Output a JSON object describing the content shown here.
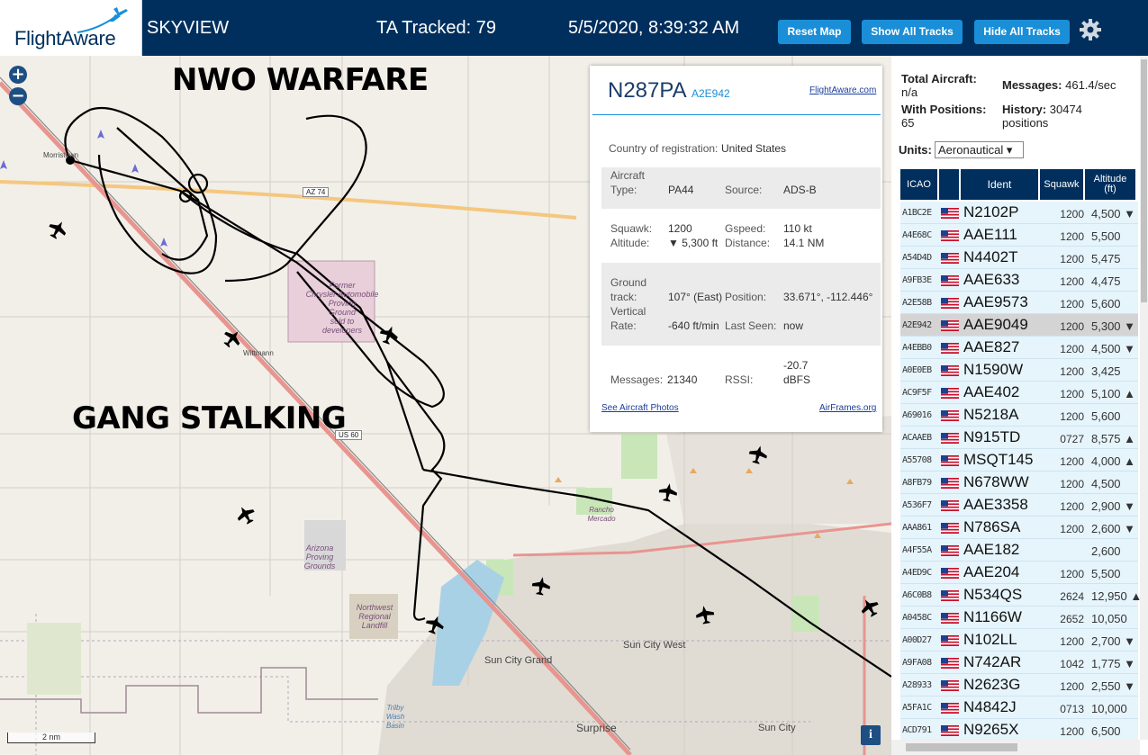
{
  "header": {
    "logo_text": "FlightAware",
    "app_name": "SKYVIEW",
    "tracked": "TA Tracked: 79",
    "datetime": "5/5/2020, 8:39:32 AM",
    "buttons": {
      "reset": "Reset Map",
      "show": "Show All Tracks",
      "hide": "Hide All Tracks"
    }
  },
  "map": {
    "zoom_in": "+",
    "zoom_out": "−",
    "overlay_top": "NWO WARFARE",
    "overlay_bottom": "GANG STALKING",
    "places": {
      "morristown": "Morristown",
      "wittmann": "Wittmann",
      "sun_city_west": "Sun City West",
      "sun_city_grand": "Sun City Grand",
      "sun_city": "Sun City",
      "surprise": "Surprise",
      "former": "Former",
      "chrysler": "Chrysler Automobile",
      "proving": "Proving",
      "ground": "Ground",
      "sold": "sold to",
      "developers": "developers",
      "arizona": "Arizona",
      "proving2": "Proving",
      "grounds": "Grounds",
      "northwest": "Northwest",
      "regional": "Regional",
      "landfill": "Landfill",
      "rancho": "Rancho",
      "mercado": "Mercado",
      "trilby": "Trilby",
      "wash": "Wash",
      "basin": "Basin"
    },
    "shields": {
      "az74": "AZ 74",
      "us60": "US 60"
    },
    "scale": "2 nm",
    "info": "i"
  },
  "popup": {
    "ident": "N287PA",
    "hex": "A2E942",
    "fa_link": "FlightAware.com",
    "country_label": "Country of registration:",
    "country": "United States",
    "aircraft_label": "Aircraft",
    "type_label": "Type:",
    "type": "PA44",
    "source_label": "Source:",
    "source": "ADS-B",
    "squawk_label": "Squawk:",
    "squawk": "1200",
    "gspeed_label": "Gspeed:",
    "gspeed": "110 kt",
    "altitude_label": "Altitude:",
    "altitude": "▼ 5,300 ft",
    "distance_label": "Distance:",
    "distance": "14.1 NM",
    "ground_label": "Ground",
    "track_label": "track:",
    "track": "107° (East)",
    "position_label": "Position:",
    "position": "33.671°, -112.446°",
    "vertical_label": "Vertical",
    "rate_label": "Rate:",
    "rate": "-640 ft/min",
    "lastseen_label": "Last Seen:",
    "lastseen": "now",
    "messages_label": "Messages:",
    "messages": "21340",
    "rssi_label": "RSSI:",
    "rssi_1": "-20.7",
    "rssi_2": "dBFS",
    "photos_link": "See Aircraft Photos",
    "airframes_link": "AirFrames.org"
  },
  "sidebar": {
    "total_label": "Total Aircraft:",
    "total_value": "n/a",
    "messages_label": "Messages:",
    "messages_value": "461.4/sec",
    "positions_label": "With Positions:",
    "positions_value": "65",
    "history_label": "History:",
    "history_value": "30474",
    "history_unit": "positions",
    "units_label": "Units:",
    "units_value": "Aeronautical ▾",
    "columns": {
      "icao": "ICAO",
      "ident": "Ident",
      "squawk": "Squawk",
      "alt1": "Altitude",
      "alt2": "(ft)"
    },
    "rows": [
      {
        "icao": "A1BC2E",
        "ident": "N2102P",
        "squawk": "1200",
        "alt": "4,500 ▼"
      },
      {
        "icao": "A4E68C",
        "ident": "AAE111",
        "squawk": "1200",
        "alt": "5,500"
      },
      {
        "icao": "A54D4D",
        "ident": "N4402T",
        "squawk": "1200",
        "alt": "5,475"
      },
      {
        "icao": "A9FB3E",
        "ident": "AAE633",
        "squawk": "1200",
        "alt": "4,475"
      },
      {
        "icao": "A2E58B",
        "ident": "AAE9573",
        "squawk": "1200",
        "alt": "5,600"
      },
      {
        "icao": "A2E942",
        "ident": "AAE9049",
        "squawk": "1200",
        "alt": "5,300 ▼"
      },
      {
        "icao": "A4EBB0",
        "ident": "AAE827",
        "squawk": "1200",
        "alt": "4,500 ▼"
      },
      {
        "icao": "A0E0EB",
        "ident": "N1590W",
        "squawk": "1200",
        "alt": "3,425"
      },
      {
        "icao": "AC9F5F",
        "ident": "AAE402",
        "squawk": "1200",
        "alt": "5,100 ▲"
      },
      {
        "icao": "A69016",
        "ident": "N5218A",
        "squawk": "1200",
        "alt": "5,600"
      },
      {
        "icao": "ACAAEB",
        "ident": "N915TD",
        "squawk": "0727",
        "alt": "8,575 ▲"
      },
      {
        "icao": "A55708",
        "ident": "MSQT145",
        "squawk": "1200",
        "alt": "4,000 ▲"
      },
      {
        "icao": "A8FB79",
        "ident": "N678WW",
        "squawk": "1200",
        "alt": "4,500"
      },
      {
        "icao": "A536F7",
        "ident": "AAE3358",
        "squawk": "1200",
        "alt": "2,900 ▼"
      },
      {
        "icao": "AAA861",
        "ident": "N786SA",
        "squawk": "1200",
        "alt": "2,600 ▼"
      },
      {
        "icao": "A4F55A",
        "ident": "AAE182",
        "squawk": "",
        "alt": "2,600"
      },
      {
        "icao": "A4ED9C",
        "ident": "AAE204",
        "squawk": "1200",
        "alt": "5,500"
      },
      {
        "icao": "A6C0B8",
        "ident": "N534QS",
        "squawk": "2624",
        "alt": "12,950 ▲"
      },
      {
        "icao": "A0458C",
        "ident": "N1166W",
        "squawk": "2652",
        "alt": "10,050"
      },
      {
        "icao": "A00D27",
        "ident": "N102LL",
        "squawk": "1200",
        "alt": "2,700 ▼"
      },
      {
        "icao": "A9FA08",
        "ident": "N742AR",
        "squawk": "1042",
        "alt": "1,775 ▼"
      },
      {
        "icao": "A28933",
        "ident": "N2623G",
        "squawk": "1200",
        "alt": "2,550 ▼"
      },
      {
        "icao": "A5FA1C",
        "ident": "N4842J",
        "squawk": "0713",
        "alt": "10,000"
      },
      {
        "icao": "ACD791",
        "ident": "N9265X",
        "squawk": "1200",
        "alt": "6,500"
      }
    ]
  }
}
